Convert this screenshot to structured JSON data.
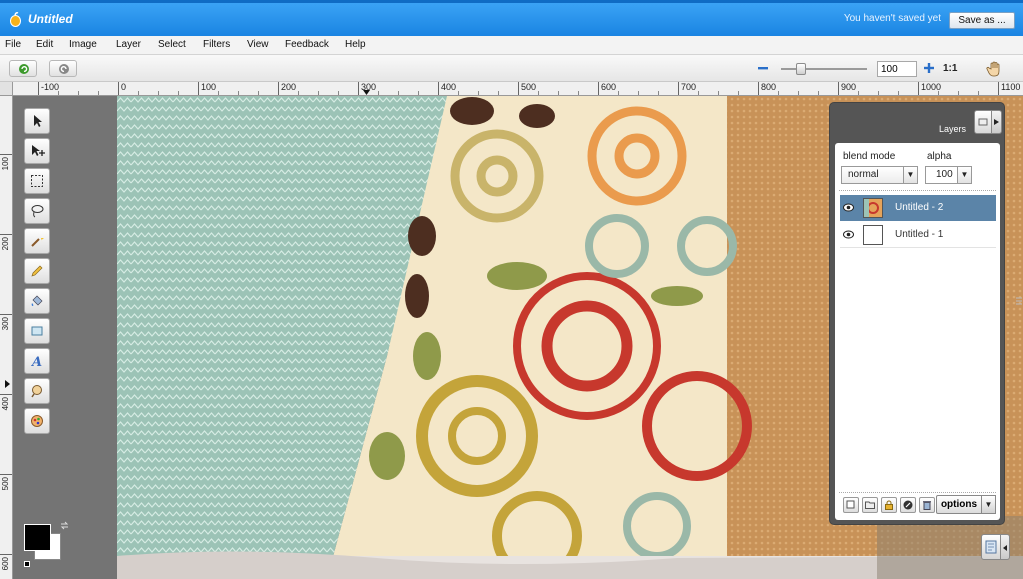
{
  "app": {
    "document_title": "Untitled",
    "save_status": "You haven't saved yet",
    "save_as_label": "Save as ..."
  },
  "menu": [
    "File",
    "Edit",
    "Image",
    "Layer",
    "Select",
    "Filters",
    "View",
    "Feedback",
    "Help"
  ],
  "toolbar": {
    "undo_icon": "undo-icon",
    "redo_icon": "redo-icon",
    "zoom_value": "100",
    "zoom_level_fraction": 0.2,
    "actual_size_label": "1:1"
  },
  "ruler": {
    "top_labels": [
      "-100",
      "0",
      "100",
      "200",
      "300",
      "400",
      "500",
      "600",
      "700",
      "800",
      "900",
      "1000",
      "1100"
    ],
    "left_labels": [
      "100",
      "200",
      "300",
      "400",
      "500",
      "600"
    ]
  },
  "tools": [
    "move-icon",
    "move-layer-icon",
    "marquee-icon",
    "lasso-icon",
    "magic-wand-icon",
    "pencil-icon",
    "paint-bucket-icon",
    "eraser-icon",
    "text-icon",
    "clone-icon",
    "color-picker-icon"
  ],
  "colors": {
    "foreground": "#000000",
    "background": "#ffffff",
    "titlebar": "#1a84e2",
    "active_layer": "#5b84a8"
  },
  "layers_panel": {
    "title": "Layers",
    "blend_mode_label": "blend mode",
    "alpha_label": "alpha",
    "blend_mode_value": "normal",
    "alpha_value": "100",
    "layers": [
      {
        "name": "Untitled - 2",
        "active": true
      },
      {
        "name": "Untitled - 1",
        "active": false
      }
    ],
    "options_label": "options"
  }
}
